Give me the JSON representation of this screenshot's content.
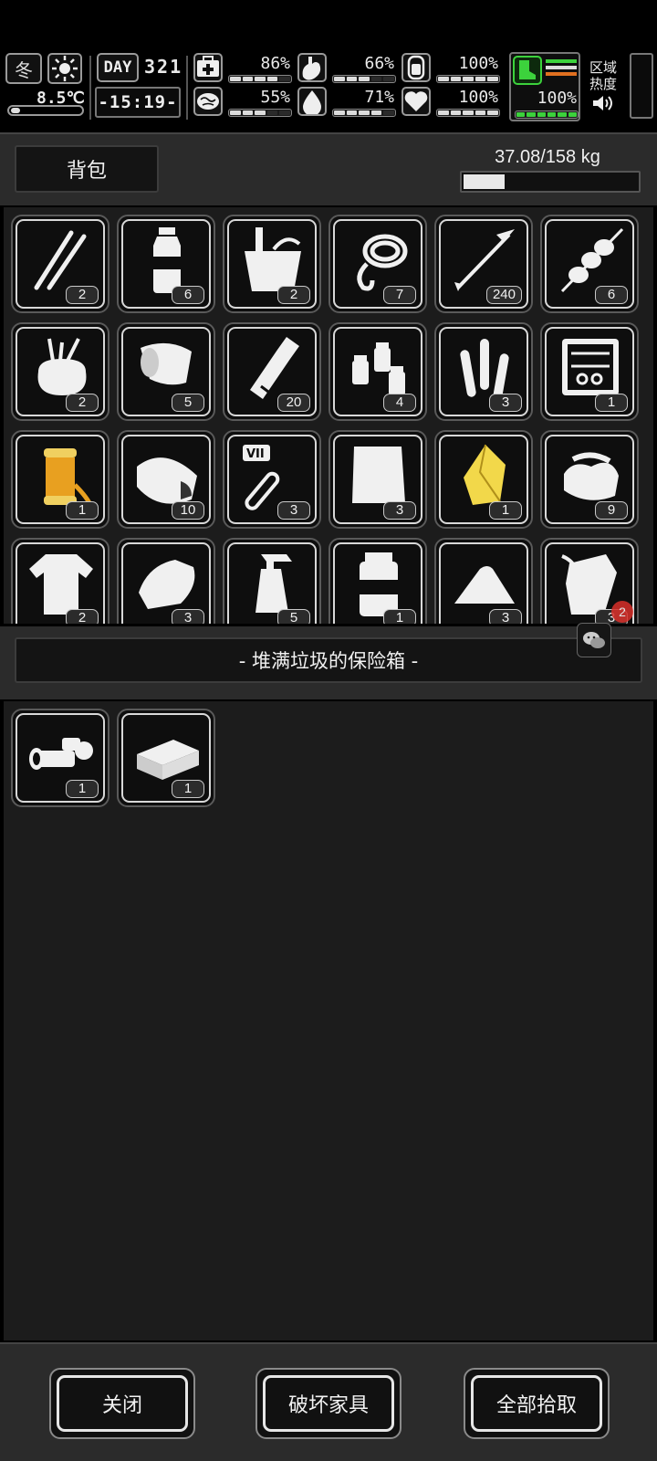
{
  "hud": {
    "season_label": "冬",
    "weather_icon": "sun-icon",
    "temperature": "8.5℃",
    "day_label": "DAY",
    "day_number": "321",
    "time": "-15:19-",
    "stats": [
      {
        "icon": "medkit-icon",
        "value": "86%",
        "fill": 0.86
      },
      {
        "icon": "stomach-icon",
        "value": "66%",
        "fill": 0.66
      },
      {
        "icon": "battery-icon",
        "value": "100%",
        "fill": 1.0
      },
      {
        "icon": "brain-icon",
        "value": "55%",
        "fill": 0.55
      },
      {
        "icon": "water-drop-icon",
        "value": "71%",
        "fill": 0.71
      },
      {
        "icon": "heart-icon",
        "value": "100%",
        "fill": 1.0
      }
    ],
    "stamina": {
      "icon": "boot-icon",
      "value": "100%",
      "fill": 1.0
    },
    "zone_heat_label": "区域热度",
    "colors": {
      "stamina_green": "#3cd23c",
      "stamina_orange": "#e07020"
    }
  },
  "backpack": {
    "tab_label": "背包",
    "weight_text": "37.08/158 kg",
    "weight_fill": 0.2347,
    "items": [
      {
        "icon": "tweezers-icon",
        "count": "2"
      },
      {
        "icon": "water-bottle-icon",
        "count": "6"
      },
      {
        "icon": "bucket-icon",
        "count": "2"
      },
      {
        "icon": "rope-hook-icon",
        "count": "7"
      },
      {
        "icon": "arrow-icon",
        "count": "240"
      },
      {
        "icon": "meat-skewer-icon",
        "count": "6"
      },
      {
        "icon": "tool-bag-icon",
        "count": "2"
      },
      {
        "icon": "bandage-roll-icon",
        "count": "5"
      },
      {
        "icon": "glass-bottle-icon",
        "count": "20"
      },
      {
        "icon": "pill-bottles-icon",
        "count": "4"
      },
      {
        "icon": "test-tubes-icon",
        "count": "3"
      },
      {
        "icon": "toolbox-icon",
        "count": "1"
      },
      {
        "icon": "gold-spool-icon",
        "count": "1"
      },
      {
        "icon": "burrito-icon",
        "count": "10"
      },
      {
        "icon": "vaccine-tube-icon",
        "count": "3"
      },
      {
        "icon": "cloth-sheet-icon",
        "count": "3"
      },
      {
        "icon": "gold-crystal-icon",
        "count": "1"
      },
      {
        "icon": "folded-cloth-icon",
        "count": "9"
      },
      {
        "icon": "ragged-shirt-icon",
        "count": "2"
      },
      {
        "icon": "towel-icon",
        "count": "3"
      },
      {
        "icon": "spray-bottle-icon",
        "count": "5"
      },
      {
        "icon": "jar-icon",
        "count": "1"
      },
      {
        "icon": "sand-pile-icon",
        "count": "3"
      },
      {
        "icon": "plastic-bag-icon",
        "count": "3"
      }
    ]
  },
  "container": {
    "title": "- 堆满垃圾的保险箱 -",
    "items": [
      {
        "icon": "rifle-scope-icon",
        "count": "1"
      },
      {
        "icon": "ammo-box-icon",
        "count": "1"
      }
    ]
  },
  "overlay": {
    "wechat_icon": "wechat-icon",
    "badge": "2"
  },
  "buttons": {
    "close": "关闭",
    "destroy_furniture": "破坏家具",
    "pick_all": "全部拾取"
  }
}
